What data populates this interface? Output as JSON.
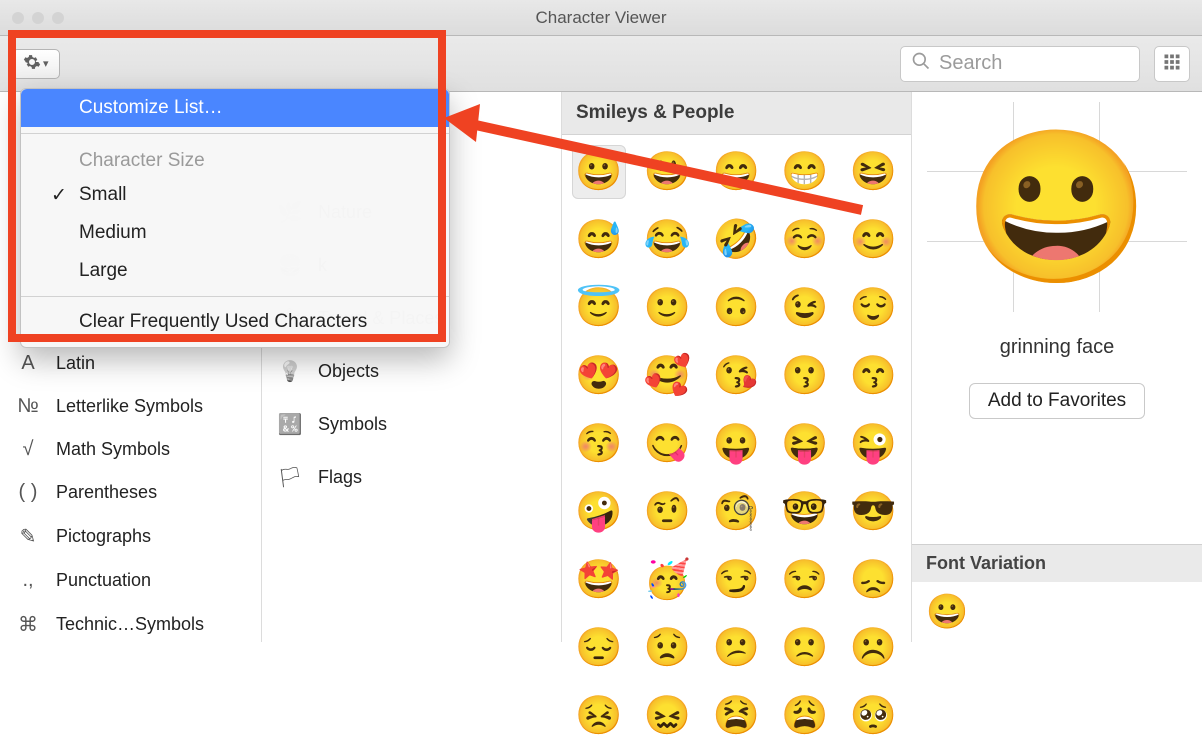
{
  "window": {
    "title": "Character Viewer"
  },
  "toolbar": {
    "search_placeholder": "Search"
  },
  "menu": {
    "customize": "Customize List…",
    "size_label": "Character Size",
    "small": "Small",
    "medium": "Medium",
    "large": "Large",
    "clear": "Clear Frequently Used Characters"
  },
  "col1": [
    {
      "icon": "A",
      "label": "Latin"
    },
    {
      "icon": "№",
      "label": "Letterlike Symbols"
    },
    {
      "icon": "√",
      "label": "Math Symbols"
    },
    {
      "icon": "( )",
      "label": "Parentheses"
    },
    {
      "icon": "✎",
      "label": "Pictographs"
    },
    {
      "icon": ".,",
      "label": "Punctuation"
    },
    {
      "icon": "⌘",
      "label": "Technic…Symbols"
    }
  ],
  "col2": [
    {
      "icon": "🌿",
      "label": "Nature"
    },
    {
      "icon": "🍔",
      "label": "k"
    },
    {
      "icon": "🏛",
      "label": "Travel & Places"
    },
    {
      "icon": "💡",
      "label": "Objects"
    },
    {
      "icon": "🔣",
      "label": "Symbols"
    },
    {
      "icon": "🏳",
      "label": "Flags"
    }
  ],
  "emoji": {
    "section": "Smileys & People",
    "cells": [
      "😀",
      "😃",
      "😄",
      "😁",
      "😆",
      "😅",
      "😂",
      "🤣",
      "☺️",
      "😊",
      "😇",
      "🙂",
      "🙃",
      "😉",
      "😌",
      "😍",
      "🥰",
      "😘",
      "😗",
      "😙",
      "😚",
      "😋",
      "😛",
      "😝",
      "😜",
      "🤪",
      "🤨",
      "🧐",
      "🤓",
      "😎",
      "🤩",
      "🥳",
      "😏",
      "😒",
      "😞",
      "😔",
      "😟",
      "😕",
      "🙁",
      "☹️",
      "😣",
      "😖",
      "😫",
      "😩",
      "🥺"
    ]
  },
  "detail": {
    "preview": "😀",
    "name": "grinning face",
    "fav": "Add to Favorites",
    "fontvar_head": "Font Variation",
    "fontvar_sample": "😀"
  }
}
